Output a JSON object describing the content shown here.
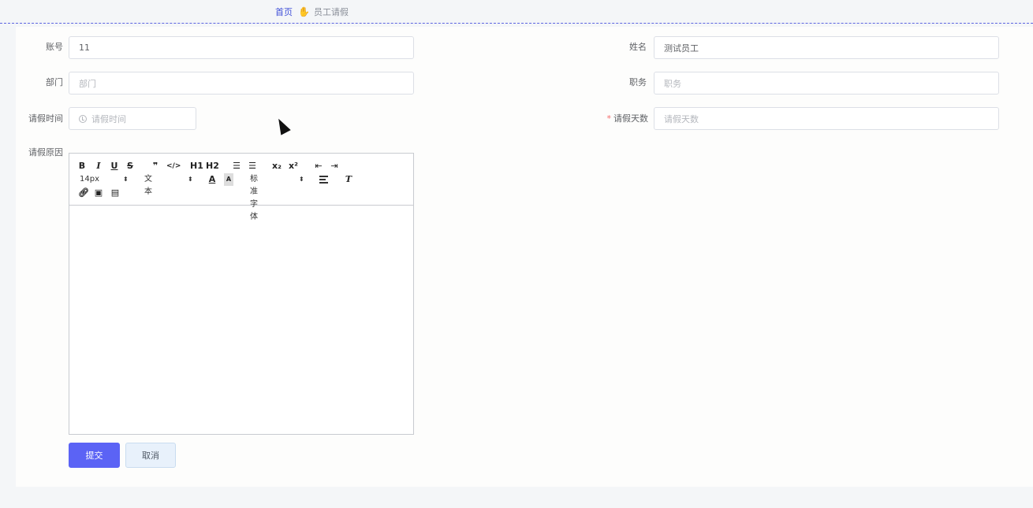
{
  "breadcrumb": {
    "home": "首页",
    "separator_icon": "hand-icon",
    "current": "员工请假"
  },
  "form": {
    "account": {
      "label": "账号",
      "value": "11"
    },
    "name": {
      "label": "姓名",
      "value": "测试员工"
    },
    "department": {
      "label": "部门",
      "placeholder": "部门"
    },
    "position": {
      "label": "职务",
      "placeholder": "职务"
    },
    "leave_time": {
      "label": "请假时间",
      "placeholder": "请假时间"
    },
    "leave_days": {
      "label": "请假天数",
      "placeholder": "请假天数",
      "required": true
    },
    "reason": {
      "label": "请假原因",
      "content": ""
    }
  },
  "editor": {
    "row1": [
      "B",
      "I",
      "U",
      "S",
      "❞",
      "</>",
      "H1",
      "H2",
      "ol",
      "ul",
      "x₂",
      "x²",
      "outdent",
      "indent"
    ],
    "size": "14px",
    "text_type": "文本",
    "font": "标准字体",
    "icons": [
      "link-icon",
      "image-icon",
      "video-icon"
    ]
  },
  "buttons": {
    "submit": "提交",
    "cancel": "取消"
  },
  "colors": {
    "primary": "#5b63f5",
    "breadcrumb_link": "#3f4fd8",
    "required": "#f56c6c"
  }
}
